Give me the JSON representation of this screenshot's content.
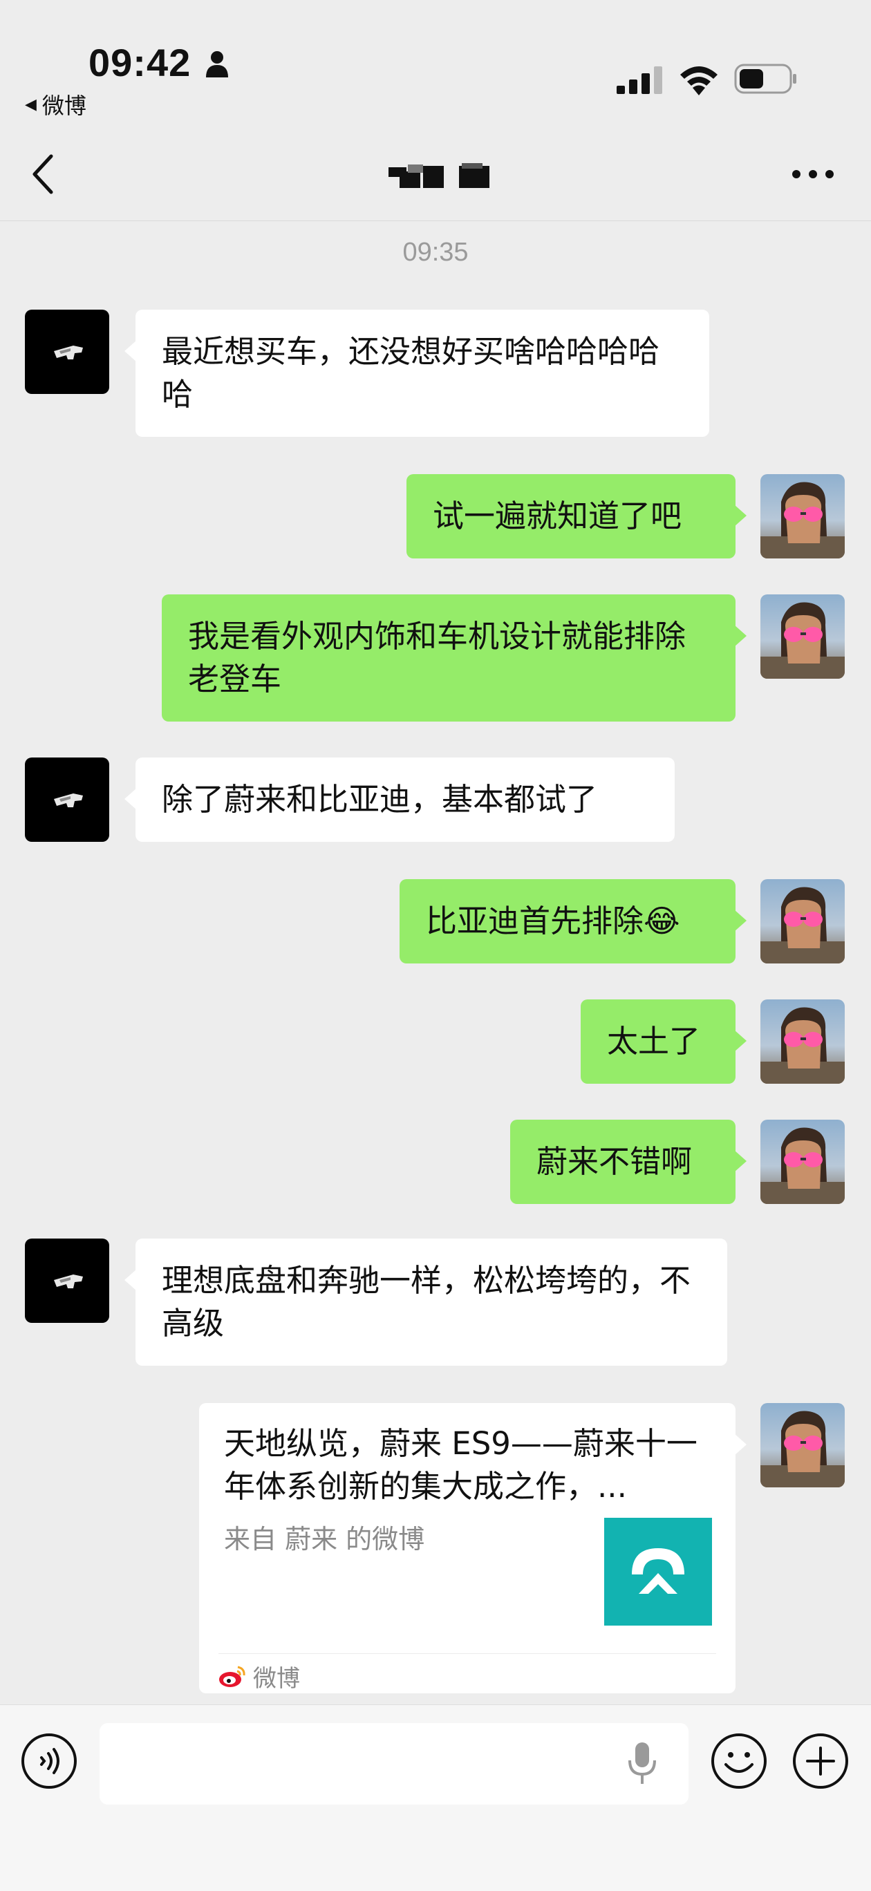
{
  "status_bar": {
    "time": "09:42",
    "back_app": "微博"
  },
  "nav": {
    "timestamp": "09:35"
  },
  "messages": [
    {
      "side": "left",
      "text": "最近想买车，还没想好买啥哈哈哈哈哈"
    },
    {
      "side": "right",
      "text": "试一遍就知道了吧"
    },
    {
      "side": "right",
      "text": "我是看外观内饰和车机设计就能排除老登车"
    },
    {
      "side": "left",
      "text": "除了蔚来和比亚迪，基本都试了"
    },
    {
      "side": "right",
      "text": "比亚迪首先排除😂"
    },
    {
      "side": "right",
      "text": "太土了"
    },
    {
      "side": "right",
      "text": "蔚来不错啊"
    },
    {
      "side": "left",
      "text": "理想底盘和奔驰一样，松松垮垮的，不高级"
    }
  ],
  "link_card": {
    "title": "天地纵览，蔚来 ES9——蔚来十一年体系创新的集大成之作，...",
    "source": "来自 蔚来 的微博",
    "footer": "微博",
    "thumb_color": "#12b3b1"
  },
  "colors": {
    "background": "#ededed",
    "bubble_self": "#95ec69",
    "bubble_other": "#ffffff"
  },
  "icons": [
    "person-icon",
    "signal-icon",
    "wifi-icon",
    "battery-icon",
    "back-icon",
    "more-icon",
    "voice-icon",
    "mic-icon",
    "emoji-icon",
    "plus-icon",
    "weibo-icon"
  ]
}
